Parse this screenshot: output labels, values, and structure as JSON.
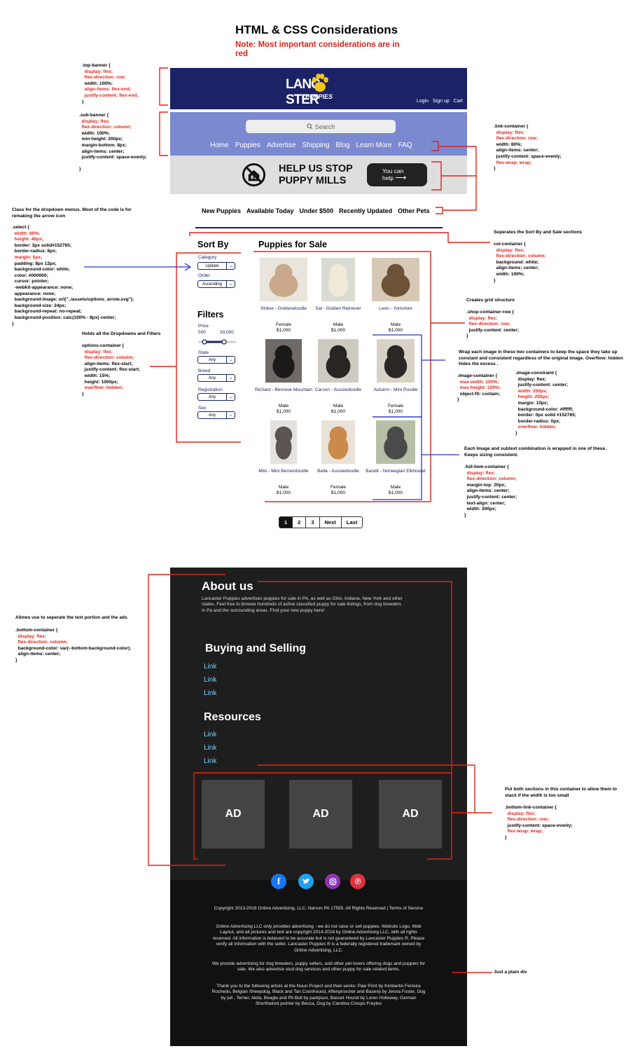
{
  "doc": {
    "title": "HTML & CSS Considerations",
    "subtitle": "Note: Most important considerations are in red"
  },
  "site": {
    "logo_main": "LANC",
    "logo_main2": "STER",
    "logo_sub": "PUPPIES",
    "auth": [
      "Login",
      "Sign up",
      "Cart"
    ],
    "search_placeholder": "Search",
    "nav": [
      "Home",
      "Puppies",
      "Advertise",
      "Shipping",
      "Blog",
      "Learn More",
      "FAQ"
    ],
    "mills_line1": "HELP US STOP",
    "mills_line2": "PUPPY MILLS",
    "help_line1": "You can",
    "help_line2": "help",
    "categories": [
      "New Puppies",
      "Available Today",
      "Under $500",
      "Recently Updated",
      "Other Pets"
    ],
    "sort_heading": "Sort By",
    "category_label": "Category",
    "category_value": "Update",
    "order_label": "Order",
    "order_value": "Ascending",
    "filters_heading": "Filters",
    "price_label": "Price",
    "price_min": "500",
    "price_max": "30,000",
    "state_label": "State",
    "breed_label": "Breed",
    "registration_label": "Registration",
    "sex_label": "Sex",
    "any": "Any",
    "sale_heading": "Puppies for Sale",
    "puppies": [
      {
        "name": "Striker - Goldendoodle",
        "sex": "Female",
        "price": "$1,000"
      },
      {
        "name": "Sal - Golden Retreiver",
        "sex": "Male",
        "price": "$1,000"
      },
      {
        "name": "Leon - Yorkshire",
        "sex": "Male",
        "price": "$1,000"
      },
      {
        "name": "Richard - Bernese Mountain",
        "sex": "Male",
        "price": "$1,000"
      },
      {
        "name": "Carson - Aussiedoodle",
        "sex": "Male",
        "price": "$1,000"
      },
      {
        "name": "Autumn - Mini Poodle",
        "sex": "Female",
        "price": "$1,000"
      },
      {
        "name": "Milo - Mini Bernerdoodle",
        "sex": "Male",
        "price": "$1,000"
      },
      {
        "name": "Bella - Aussiedoodle",
        "sex": "Female",
        "price": "$1,000"
      },
      {
        "name": "Bandit - Norwegian Elkhound",
        "sex": "Male",
        "price": "$1,000"
      }
    ],
    "pages": [
      "1",
      "2",
      "3",
      "Next",
      "Last"
    ],
    "about_heading": "About us",
    "about_text": "Lancaster Puppies advertises puppies for sale in PA, as well as Ohio, Indiana, New York and other states. Feel free to browse hundreds of active classified puppy for sale listings, from dog breeders in Pa and the surrounding areas. Find your new puppy here!",
    "buying_heading": "Buying and Selling",
    "resources_heading": "Resources",
    "link": "Link",
    "ad": "AD",
    "copyright": "Copyright 2013-2018 Online Advertising, LLC, Narvon PA 17555. All Rights Reserved | Terms of Service",
    "legal1": "Online Advertising LLC only provides advertising - we do not raise or sell puppies. Website Logo, Web Layout, and all pictures and text are copyright 2014-2018 by Online Advertising LLC, with all rights reserved. All information is believed to be accurate but is not guaranteed by Lancaster Puppies ®. Please verify all information with the seller. Lancaster Puppies ® is a federally registered trademark owned by Online Advertising, LLC.",
    "legal2": "We provide advertising for dog breeders, puppy sellers, and other pet lovers offering dogs and puppies for sale. We also advertise stud dog services and other puppy for sale related items.",
    "legal3": "Thank you to the following artists at the Noun Project and their works: Paw Print by Kimberlin Ferreira Rochedo, Belgian Sheepdog, Black and Tan Coonhound, Affenpinscher and Basenji by Jenna Foster, Dog by jull , Terrier, Akita, Beagle and Pit Bull by parkjisun, Basset Hound by Loren Holloway, German Shorthaired pointer by Becca, Dog by Carolina Crespo Freytes"
  },
  "notes": {
    "top_banner": [
      {
        "t": ".top-banner {",
        "red": false
      },
      {
        "t": "  display: flex;",
        "red": true
      },
      {
        "t": "  flex-direction: row;",
        "red": true
      },
      {
        "t": "  width: 100%;",
        "red": false
      },
      {
        "t": "  align-items: flex-end;",
        "red": true
      },
      {
        "t": "  justify-content: flex-end;",
        "red": true
      },
      {
        "t": "}",
        "red": false
      }
    ],
    "sub_banner": [
      {
        "t": ".sub-banner {",
        "red": false
      },
      {
        "t": "  display: flex;",
        "red": true
      },
      {
        "t": "  flex-direction: column;",
        "red": true
      },
      {
        "t": "  width: 100%;",
        "red": false
      },
      {
        "t": "  min-height: 200px;",
        "red": false
      },
      {
        "t": "  margin-bottom: 8px;",
        "red": false
      },
      {
        "t": "  align-items: center;",
        "red": false
      },
      {
        "t": "  justify-content: space-evenly;",
        "red": false
      },
      {
        "t": "",
        "red": false
      },
      {
        "t": "}",
        "red": false
      }
    ],
    "link_container": [
      {
        "t": ".link-container {",
        "red": false
      },
      {
        "t": "  display: flex;",
        "red": true
      },
      {
        "t": "  flex-direction: row;",
        "red": true
      },
      {
        "t": "  width: 80%;",
        "red": false
      },
      {
        "t": "  align-items: center;",
        "red": false
      },
      {
        "t": "  justify-content: space-evenly;",
        "red": false
      },
      {
        "t": "  flex-wrap: wrap;",
        "red": true
      },
      {
        "t": "}",
        "red": false
      }
    ],
    "select_intro": [
      {
        "t": "Class for the dropdown menus. Most of the code is for",
        "red": false
      },
      {
        "t": "remaking the arrow icon",
        "red": false
      }
    ],
    "select": [
      {
        "t": ".select {",
        "red": false
      },
      {
        "t": "  width: 80%;",
        "red": true
      },
      {
        "t": "  height: 40px;",
        "red": true
      },
      {
        "t": "  border: 3px solid#152765;",
        "red": false
      },
      {
        "t": "  border-radius: 8px;",
        "red": false
      },
      {
        "t": "  margin: 5px;",
        "red": true
      },
      {
        "t": "  padding: 8px 12px;",
        "red": false
      },
      {
        "t": "  background-color: white;",
        "red": false
      },
      {
        "t": "  color: #000000;",
        "red": false
      },
      {
        "t": "  cursor: pointer;",
        "red": false
      },
      {
        "t": "  -webkit-appearance: none;",
        "red": false
      },
      {
        "t": "  appearance: none;",
        "red": false
      },
      {
        "t": "  background-image: url(\"../assets/options_arrow.svg\");",
        "red": false
      },
      {
        "t": "  background-size: 24px;",
        "red": false
      },
      {
        "t": "  background-repeat: no-repeat;",
        "red": false
      },
      {
        "t": "  background-position: calc(100% - 8px) center;",
        "red": false
      },
      {
        "t": "}",
        "red": false
      }
    ],
    "options_intro": [
      {
        "t": "Holds all the Dropdowns and Filters",
        "red": false
      }
    ],
    "options": [
      {
        "t": "options-container {",
        "red": false
      },
      {
        "t": "  display: flex;",
        "red": true
      },
      {
        "t": "  flex-direction: column;",
        "red": true
      },
      {
        "t": "  align-items: flex-start;",
        "red": false
      },
      {
        "t": "  justify-content: flex-start;",
        "red": false
      },
      {
        "t": "  width: 15%;",
        "red": false
      },
      {
        "t": "  height: 1000px;",
        "red": false
      },
      {
        "t": "  overflow: hidden;",
        "red": true
      },
      {
        "t": "}",
        "red": false
      }
    ],
    "col_intro": [
      {
        "t": "Seperates the Sort By and Sale sections",
        "red": false
      }
    ],
    "col": [
      {
        "t": "col-container {",
        "red": false
      },
      {
        "t": "  display: flex;",
        "red": true
      },
      {
        "t": "  flex-direction: column;",
        "red": true
      },
      {
        "t": "  background: white;",
        "red": false
      },
      {
        "t": "  align-items: center;",
        "red": false
      },
      {
        "t": "  width: 100%;",
        "red": false
      },
      {
        "t": "}",
        "red": false
      }
    ],
    "grid_intro": [
      {
        "t": "Creates grid structure",
        "red": false
      }
    ],
    "grid": [
      {
        "t": ".shop-container-row {",
        "red": false
      },
      {
        "t": "  display: flex;",
        "red": true
      },
      {
        "t": "  flex-direction: row;",
        "red": true
      },
      {
        "t": "  justify-content: center;",
        "red": false
      },
      {
        "t": "}",
        "red": false
      }
    ],
    "wrap_intro": [
      {
        "t": "Wrap each image in these two containers to keep the space they take up",
        "red": false
      },
      {
        "t": "constant and consistent regardless of the original image. Overflow: hidden",
        "red": false
      },
      {
        "t": "hides the excess .",
        "red": false
      }
    ],
    "image_container": [
      {
        "t": ".image-container {",
        "red": false
      },
      {
        "t": "  max-width: 100%;",
        "red": true
      },
      {
        "t": "  max-height: 100%;",
        "red": true
      },
      {
        "t": "  object-fit: contain;",
        "red": false
      },
      {
        "t": "}",
        "red": false
      }
    ],
    "image_constraint": [
      {
        "t": ".image-constraint {",
        "red": false
      },
      {
        "t": "  display: flex;",
        "red": false
      },
      {
        "t": "  justify-content: center;",
        "red": false
      },
      {
        "t": "  width: 250px;",
        "red": true
      },
      {
        "t": "  height: 250px;",
        "red": true
      },
      {
        "t": "  margin: 10px;",
        "red": false
      },
      {
        "t": "  background-color: #ffffff;",
        "red": false
      },
      {
        "t": "  border: 0px solid #152765;",
        "red": false
      },
      {
        "t": "  border-radius: 0px;",
        "red": false
      },
      {
        "t": "  overflow: hidden;",
        "red": true
      },
      {
        "t": "}",
        "red": false
      }
    ],
    "full_intro": [
      {
        "t": "Each Image and subtext combination is wrapped in one of these.",
        "red": false
      },
      {
        "t": "Keeps sizing consistent.",
        "red": false
      }
    ],
    "full_item": [
      {
        "t": ".full-item-container {",
        "red": false
      },
      {
        "t": "  display: flex;",
        "red": true
      },
      {
        "t": "  flex-direction: column;",
        "red": true
      },
      {
        "t": "  margin-top: 20px;",
        "red": false
      },
      {
        "t": "  align-items: center;",
        "red": false
      },
      {
        "t": "  justify-content: center;",
        "red": false
      },
      {
        "t": "  text-align: center;",
        "red": false
      },
      {
        "t": "  width: 300px;",
        "red": false
      },
      {
        "t": "}",
        "red": false
      }
    ],
    "bottom_intro": [
      {
        "t": "Allows use to seperate the text portion and the ads",
        "red": false
      }
    ],
    "bottom_container": [
      {
        "t": ".bottom-container {",
        "red": false
      },
      {
        "t": "  display: flex;",
        "red": true
      },
      {
        "t": "  flex-direction: column;",
        "red": true
      },
      {
        "t": "  background-color: var(--bottom-background-color);",
        "red": false
      },
      {
        "t": "  align-items: center;",
        "red": false
      },
      {
        "t": "}",
        "red": false
      }
    ],
    "bottom_link_intro": [
      {
        "t": "Put both sections in this container to allow them to",
        "red": false
      },
      {
        "t": "stack if the width is too small",
        "red": false
      }
    ],
    "bottom_link": [
      {
        "t": ".bottom-link-container {",
        "red": false
      },
      {
        "t": "  display: flex;",
        "red": true
      },
      {
        "t": "  flex-direction: row;",
        "red": true
      },
      {
        "t": "  justify-content: space-evenly;",
        "red": false
      },
      {
        "t": "  flex-wrap: wrap;",
        "red": true
      },
      {
        "t": "}",
        "red": false
      }
    ],
    "plain_div": [
      {
        "t": "Just a plain div",
        "red": false
      }
    ]
  },
  "colors": {
    "annotation_red": "#e0231a",
    "annotation_blue": "#2a32c9",
    "navy": "#1b2266",
    "periwinkle": "#7b89d1"
  }
}
